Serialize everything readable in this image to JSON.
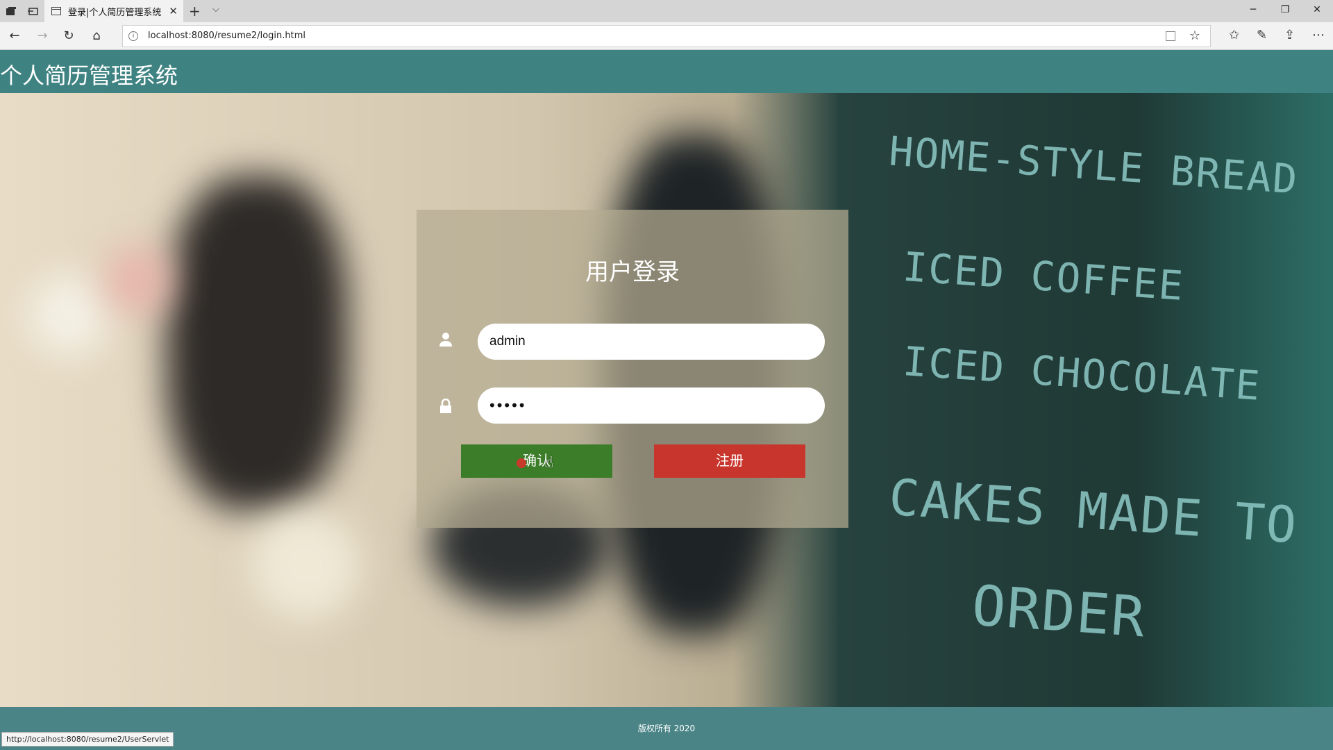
{
  "browser": {
    "tab_title": "登录|个人简历管理系统",
    "url": "localhost:8080/resume2/login.html",
    "status_url": "http://localhost:8080/resume2/UserServlet"
  },
  "page": {
    "site_title": "个人简历管理系统",
    "login_title": "用户登录",
    "username_value": "admin",
    "password_mask": "•••••",
    "confirm_label": "确认",
    "register_label": "注册",
    "footer_text": "版权所有 2020"
  },
  "background_chalk": [
    "HOME-STYLE BREAD",
    "ICED COFFEE",
    "ICED CHOCOLATE",
    "CAKES MADE TO",
    "ORDER"
  ],
  "colors": {
    "header": "#3e8282",
    "confirm": "#3b7d29",
    "register": "#c8352c"
  }
}
